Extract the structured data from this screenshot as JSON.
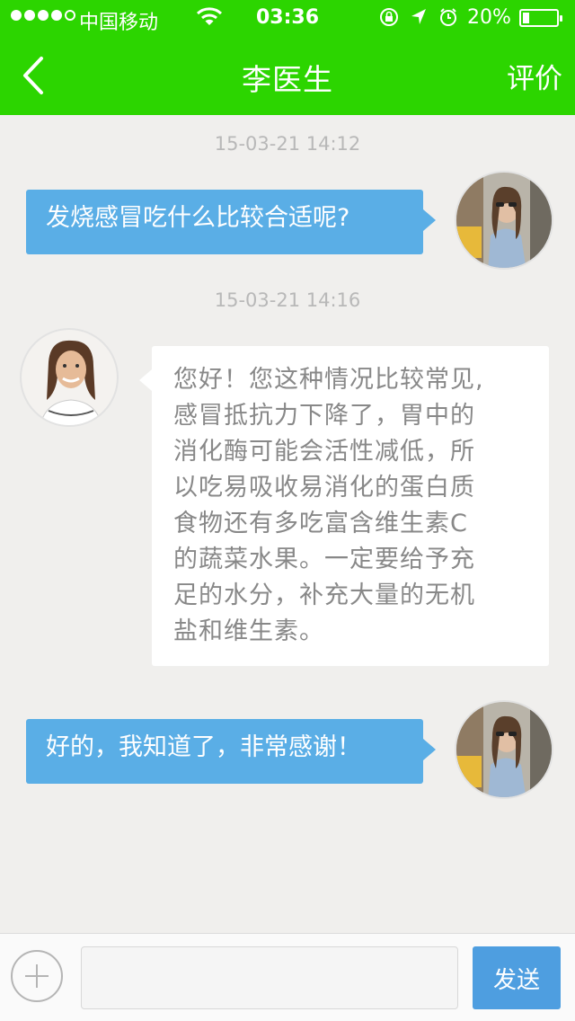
{
  "status_bar": {
    "carrier": "中国移动",
    "time": "03:36",
    "battery_percent": "20%",
    "battery_level": 0.2,
    "signal_bars": 4
  },
  "navbar": {
    "title": "李医生",
    "back_icon": "chevron-left-icon",
    "rate_label": "评价"
  },
  "messages": [
    {
      "timestamp": "15-03-21 14:12",
      "sender": "me",
      "text": "发烧感冒吃什么比较合适呢?"
    },
    {
      "timestamp": "15-03-21 14:16",
      "sender": "doctor",
      "lines": [
        "您好！您这种情况比较常见,",
        "感冒抵抗力下降了，胃中的",
        "消化酶可能会活性减低，所",
        "以吃易吸收易消化的蛋白质",
        "食物还有多吃富含维生素C",
        "的蔬菜水果。一定要给予充",
        "足的水分，补充大量的无机",
        "盐和维生素。"
      ]
    },
    {
      "sender": "me",
      "text": "好的，我知道了，非常感谢！"
    }
  ],
  "input_bar": {
    "placeholder": "",
    "send_label": "发送",
    "plus_icon": "plus-circle-icon"
  },
  "colors": {
    "header": "#2cd500",
    "my_bubble": "#5aaee6",
    "send_button": "#4e9ee0",
    "background": "#f0efed"
  }
}
